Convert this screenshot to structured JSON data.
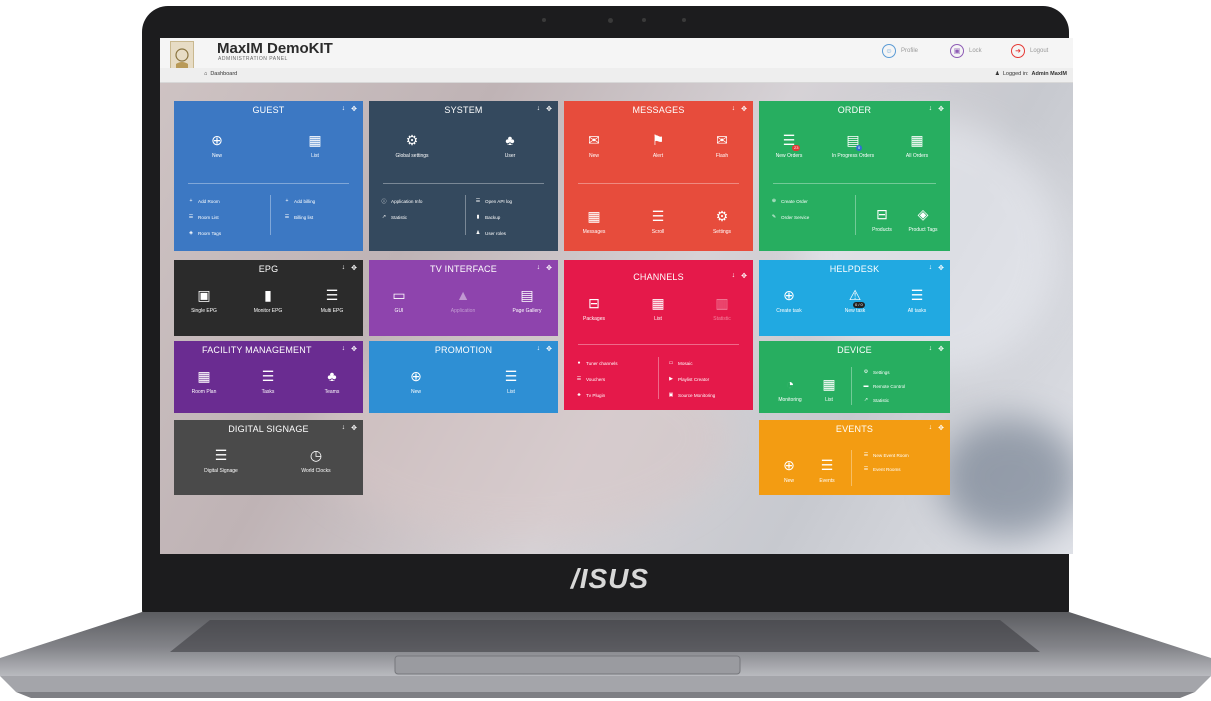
{
  "app": {
    "title": "MaxIM DemoKIT",
    "subtitle": "ADMINISTRATION PANEL",
    "breadcrumb": "Dashboard",
    "logged_in_label": "Logged in:",
    "logged_in_user": "Admin MaxIM",
    "profile_label": "Profile",
    "lock_label": "Lock",
    "logout_label": "Logout"
  },
  "laptop_brand": "/ISUS",
  "colors": {
    "guest": "#3c78c3",
    "system": "#34495e",
    "messages": "#e74c3c",
    "order": "#27ae60",
    "epg": "#2b2b2b",
    "tv": "#8e44ad",
    "channels": "#e5194a",
    "helpdesk": "#21a9e1",
    "facility": "#6a2c91",
    "promotion": "#2e8fd4",
    "device": "#27ae60",
    "signage": "#4a4a4a",
    "events": "#f39c12",
    "logout_red": "#e53935",
    "profile_blue": "#5b9bd5",
    "lock_purple": "#8e5bb5"
  },
  "tiles": {
    "guest": {
      "title": "GUEST",
      "new": "New",
      "list": "List",
      "add_room": "Add Room",
      "room_list": "Room List",
      "room_tags": "Room Tags",
      "add_billing": "Add billing",
      "billing_list": "Billing list"
    },
    "system": {
      "title": "SYSTEM",
      "global_settings": "Global settings",
      "user": "User",
      "application_info": "Application Info",
      "statistic": "Statistic",
      "open_api_log": "Open API log",
      "backup": "Backup",
      "user_roles": "User roles"
    },
    "messages": {
      "title": "MESSAGES",
      "new": "New",
      "alert": "Alert",
      "flash": "Flash",
      "messages": "Messages",
      "scroll": "Scroll",
      "settings": "Settings"
    },
    "order": {
      "title": "ORDER",
      "new_orders": "New Orders",
      "new_orders_count": "23",
      "in_progress": "In Progress Orders",
      "in_progress_count": "0",
      "all_orders": "All Orders",
      "create_order": "Create Order",
      "order_service": "Order Service",
      "products": "Products",
      "product_tags": "Product Tags"
    },
    "epg": {
      "title": "EPG",
      "single": "Single EPG",
      "monitor": "Monitor EPG",
      "multi": "Multi EPG"
    },
    "tv": {
      "title": "TV INTERFACE",
      "gui": "GUI",
      "application": "Application",
      "page_gallery": "Page Gallery"
    },
    "channels": {
      "title": "CHANNELS",
      "packages": "Packages",
      "list": "List",
      "statistic": "Statistic",
      "tuner_channels": "Tuner channels",
      "vouchers": "Vouchers",
      "tv_plugin": "Tv Plugin",
      "mosaic": "Mosaic",
      "playlist_creator": "Playlist Creator",
      "source_monitoring": "Source Monitoring"
    },
    "helpdesk": {
      "title": "HELPDESK",
      "create_task": "Create task",
      "new_task": "New task",
      "new_task_count": "0 / 0",
      "all_tasks": "All tasks"
    },
    "facility": {
      "title": "FACILITY MANAGEMENT",
      "room_plan": "Room Plan",
      "tasks": "Tasks",
      "teams": "Teams"
    },
    "promotion": {
      "title": "PROMOTION",
      "new": "New",
      "list": "List"
    },
    "device": {
      "title": "DEVICE",
      "monitoring": "Monitoring",
      "list": "List",
      "settings": "Settings",
      "remote_control": "Remote Control",
      "statistic": "Statistic"
    },
    "signage": {
      "title": "DIGITAL SIGNAGE",
      "digital_signage": "Digital Signage",
      "world_clocks": "World Clocks"
    },
    "events": {
      "title": "EVENTS",
      "new": "New",
      "events": "Events",
      "new_event_room": "New Event Room",
      "event_rooms": "Event Rooms"
    }
  }
}
